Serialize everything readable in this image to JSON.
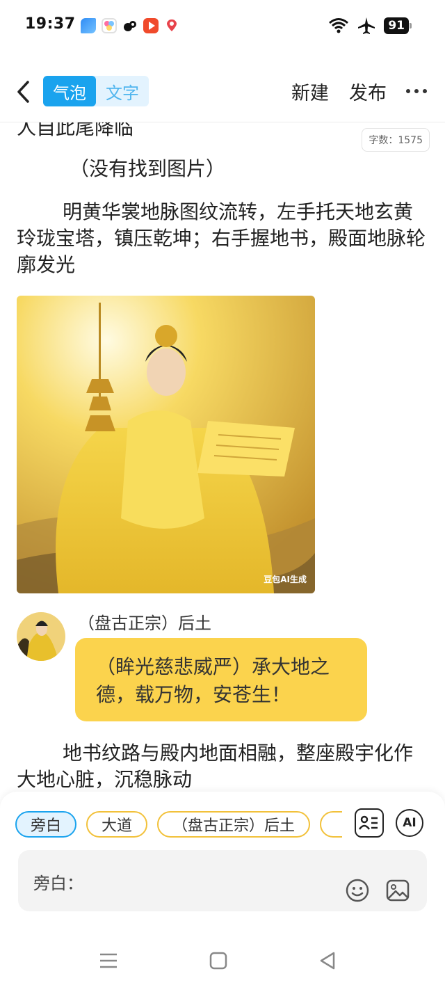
{
  "status_bar": {
    "time": "19:37",
    "battery": "91",
    "notification_icons": [
      "app-blue-icon",
      "app-colorful-icon",
      "app-black-icon",
      "video-app-icon",
      "pin-app-icon"
    ],
    "system_icons": [
      "wifi-icon",
      "airplane-icon",
      "battery-icon"
    ]
  },
  "toolbar": {
    "mode_bubble": "气泡",
    "mode_text": "文字",
    "new_label": "新建",
    "publish_label": "发布",
    "accent_color": "#1aa3ee"
  },
  "content": {
    "word_count": "字数：1575",
    "cut_line": "人自此尾降临",
    "no_image_note": "（没有找到图片）",
    "paragraph_1": "明黄华裳地脉图纹流转，左手托天地玄黄玲珑宝塔，镇压乾坤；右手握地书，殿面地脉轮廓发光",
    "image_watermark": "豆包AI生成",
    "speaker_name": "（盘古正宗）后土",
    "dialogue": "（眸光慈悲威严）承大地之德，载万物，安苍生！",
    "bubble_color": "#fbd34d",
    "paragraph_2": "地书纹路与殿内地面相融，整座殿宇化作大地心脏，沉稳脉动"
  },
  "input_panel": {
    "chips": [
      "旁白",
      "大道",
      "（盘古正宗）后土",
      "（"
    ],
    "selected_chip": "旁白",
    "ai_label": "AI",
    "input_label": "旁白："
  }
}
